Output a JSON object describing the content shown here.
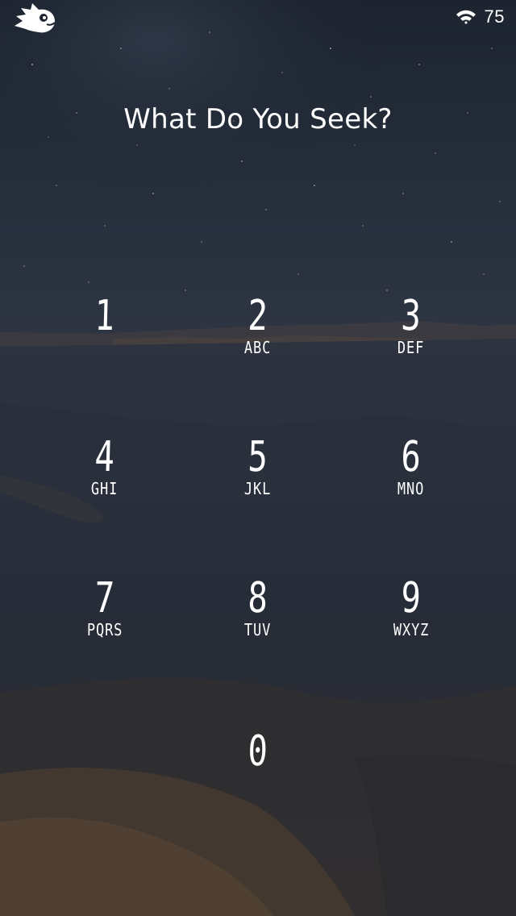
{
  "status_bar": {
    "logo_icon": "hedgehog-logo-icon",
    "wifi_icon": "wifi-icon",
    "battery": "75"
  },
  "prompt": {
    "title": "What Do You Seek?"
  },
  "keypad": {
    "keys": [
      {
        "digit": "1",
        "letters": ""
      },
      {
        "digit": "2",
        "letters": "ABC"
      },
      {
        "digit": "3",
        "letters": "DEF"
      },
      {
        "digit": "4",
        "letters": "GHI"
      },
      {
        "digit": "5",
        "letters": "JKL"
      },
      {
        "digit": "6",
        "letters": "MNO"
      },
      {
        "digit": "7",
        "letters": "PQRS"
      },
      {
        "digit": "8",
        "letters": "TUV"
      },
      {
        "digit": "9",
        "letters": "WXYZ"
      },
      {
        "digit": "0",
        "letters": ""
      }
    ]
  },
  "colors": {
    "text": "#ffffff",
    "sky": "#222a38",
    "sand": "#3a3530"
  }
}
